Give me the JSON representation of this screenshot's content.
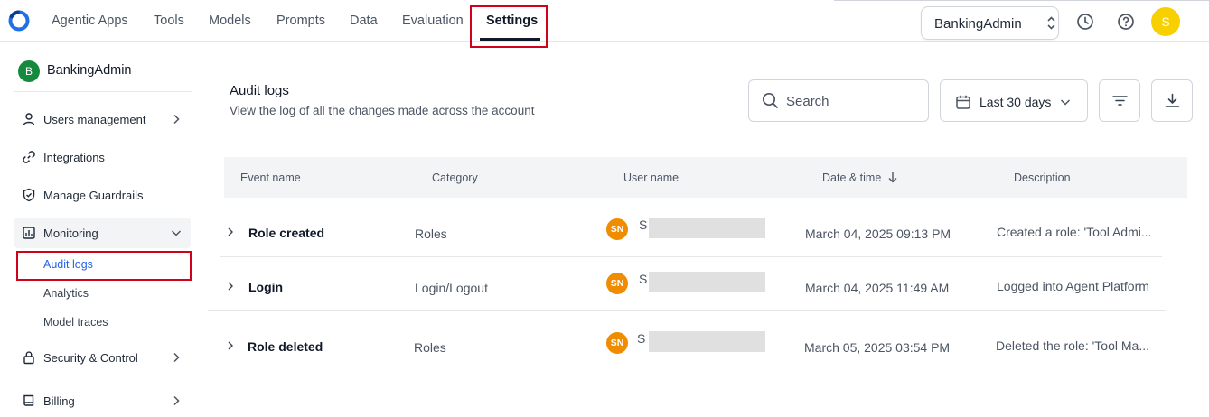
{
  "nav": {
    "items": [
      "Agentic Apps",
      "Tools",
      "Models",
      "Prompts",
      "Data",
      "Evaluation",
      "Settings"
    ],
    "active": "Settings",
    "workspace": "BankingAdmin",
    "user_initial": "S",
    "icons": [
      "logo-icon",
      "history-icon",
      "help-icon"
    ]
  },
  "sidebar": {
    "org_initial": "B",
    "org_name": "BankingAdmin",
    "items": [
      {
        "label": "Users management",
        "icon": "user-icon",
        "chevron": "right"
      },
      {
        "label": "Integrations",
        "icon": "link-icon"
      },
      {
        "label": "Manage Guardrails",
        "icon": "shield-check-icon"
      },
      {
        "label": "Monitoring",
        "icon": "chart-icon",
        "chevron": "down",
        "expanded": true
      },
      {
        "label": "Security & Control",
        "icon": "lock-icon",
        "chevron": "right"
      },
      {
        "label": "Billing",
        "icon": "book-icon",
        "chevron": "right"
      }
    ],
    "monitoring_sub": [
      "Audit logs",
      "Analytics",
      "Model traces"
    ],
    "active_sub": "Audit logs"
  },
  "page": {
    "title": "Audit logs",
    "subtitle": "View the log of all the changes made across the account",
    "search_placeholder": "Search",
    "date_range": "Last 30 days"
  },
  "table": {
    "columns": [
      "Event name",
      "Category",
      "User name",
      "Date & time",
      "Description"
    ],
    "rows": [
      {
        "event": "Role created",
        "category": "Roles",
        "user_initials": "SN",
        "user_name": "S",
        "datetime": "March 04, 2025 09:13 PM",
        "description": "Created a role: 'Tool Admi..."
      },
      {
        "event": "Login",
        "category": "Login/Logout",
        "user_initials": "SN",
        "user_name": "S",
        "datetime": "March 04, 2025 11:49 AM",
        "description": "Logged into Agent Platform"
      },
      {
        "event": "Role deleted",
        "category": "Roles",
        "user_initials": "SN",
        "user_name": "S",
        "datetime": "March 05, 2025 03:54 PM",
        "description": "Deleted the role: 'Tool Ma..."
      }
    ]
  },
  "colors": {
    "accent": "#2563eb",
    "highlight": "#d0021b",
    "org_badge": "#168a3c",
    "user_badge": "#f08c00",
    "top_avatar": "#f8d000"
  }
}
